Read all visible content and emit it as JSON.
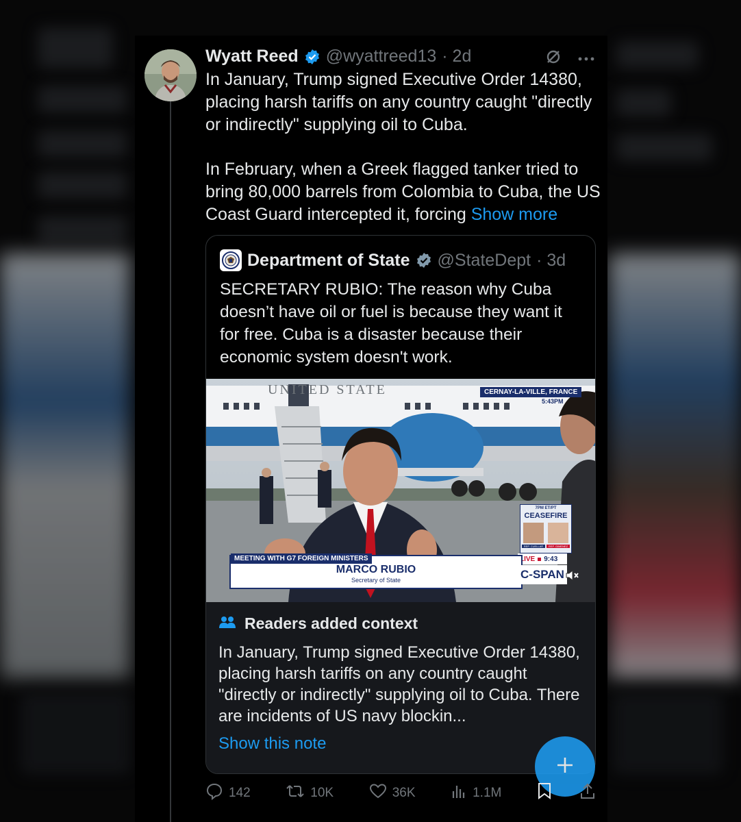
{
  "tweet": {
    "author_name": "Wyatt Reed",
    "handle": "@wyattreed13",
    "time": "· 2d",
    "paragraph_1": "In January, Trump signed Executive Order 14380, placing harsh tariffs on any country caught \"directly or indirectly\" supplying oil to Cuba.",
    "paragraph_2": "In February, when a Greek flagged tanker tried to bring 80,000 barrels from Colombia to Cuba, the US Coast Guard intercepted it, forcing",
    "show_more": "Show more"
  },
  "quote": {
    "author_name": "Department of State",
    "handle": "@StateDept",
    "time": "· 3d",
    "text": "SECRETARY RUBIO: The reason why Cuba doesn’t have oil or fuel is because they want it for free. Cuba is a disaster because their economic system doesn't work.",
    "video": {
      "aircraft_text": "UNITED STATES OF AME",
      "location": "CERNAY-LA-VILLE, FRANCE",
      "local_time": "5:43PM",
      "meeting_tag": "MEETING WITH G7 FOREIGN MINISTERS",
      "name": "MARCO RUBIO",
      "title": "Secretary of State",
      "promo_time": "7PM ET/PT",
      "promo_title": "CEASEFIRE",
      "promo_guest_1": "REP. CUELLAR",
      "promo_guest_2": "REP. GIMENEZ",
      "live_label": "LIVE",
      "live_time": "9:43",
      "network": "C-SPAN"
    }
  },
  "context": {
    "title": "Readers added context",
    "body": "In January, Trump signed Executive Order 14380, placing harsh tariffs on any country caught \"directly or indirectly\" supplying oil to Cuba. There are incidents of US navy blockin...",
    "link": "Show this note"
  },
  "actions": {
    "replies": "142",
    "reposts": "10K",
    "likes": "36K",
    "views": "1.1M"
  },
  "colors": {
    "accent": "#1d9bf0",
    "muted": "#71767b",
    "background": "#000000"
  }
}
